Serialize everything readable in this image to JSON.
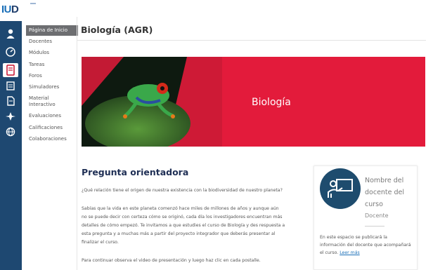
{
  "brand": {
    "logo_prefix": "IU",
    "logo_suffix": "D"
  },
  "rail": {
    "icons": [
      "user-icon",
      "dashboard-icon",
      "course-icon",
      "calendar-icon",
      "document-icon",
      "tools-icon",
      "globe-icon"
    ],
    "active_index": 2
  },
  "course_menu": {
    "items": [
      "Página de Inicio",
      "Docentes",
      "Módulos",
      "Tareas",
      "Foros",
      "Simuladores",
      "Material",
      "Interactivo",
      "Evaluaciones",
      "Calificaciones",
      "Colaboraciones"
    ],
    "active_index": 0
  },
  "page": {
    "title": "Biología (AGR)"
  },
  "banner": {
    "title": "Biología"
  },
  "section": {
    "title": "Pregunta orientadora",
    "p1": "¿Qué relación tiene el origen de nuestra existencia con la biodiversidad de nuestro planeta?",
    "p2": "Sabías que la vida en este planeta comenzó hace miles de millones de años y aunque aún no se puede decir con certeza cómo se originó, cada día los investigadores encuentran más detalles de cómo empezó. Te invitamos a que estudies el curso de Biología y des respuesta a esta pregunta y a muchas más a partir del proyecto integrador que deberás presentar al finalizar el curso.",
    "p3": "Para continuar observa el video de presentación y luego haz clic en cada postalle."
  },
  "teacher_card": {
    "name": "Nombre del docente del curso",
    "role": "Docente",
    "text": "En este espacio se publicará la información del docente que acompañará el curso.",
    "link": "Leer más"
  },
  "colors": {
    "rail": "#1e4871",
    "banner": "#e31b3b",
    "menu_active": "#6d6e71",
    "avatar": "#1e4c6e",
    "link": "#1a6fb8"
  }
}
